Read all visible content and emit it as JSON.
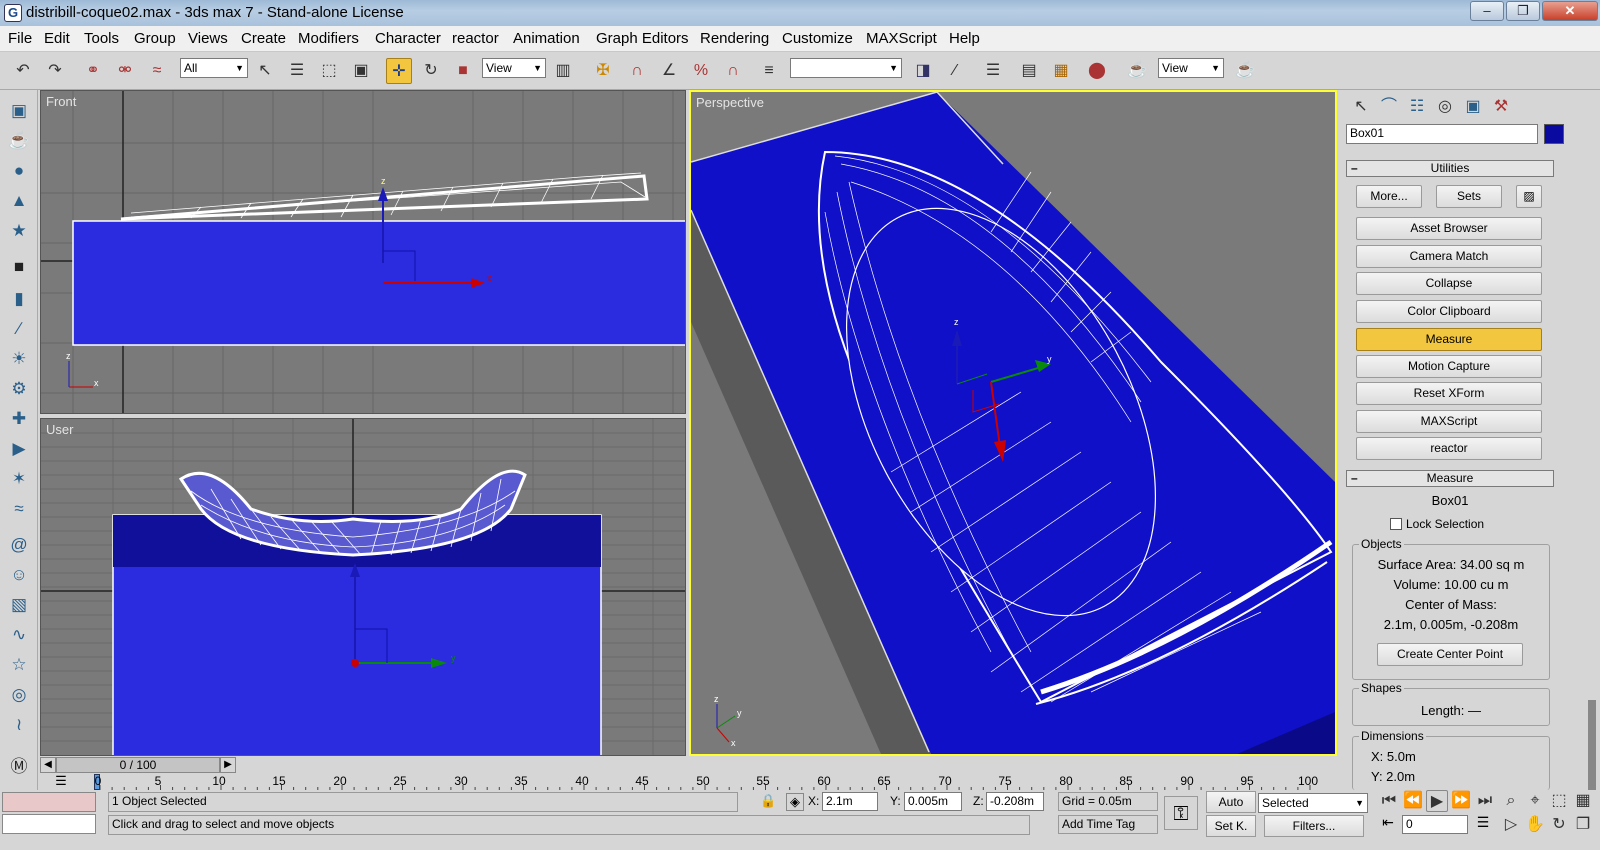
{
  "window": {
    "title": "distribill-coque02.max - 3ds max 7  - Stand-alone License",
    "app_icon": "G",
    "controls": [
      "minimize-icon",
      "maximize-icon",
      "close-icon"
    ]
  },
  "menu": [
    "File",
    "Edit",
    "Tools",
    "Group",
    "Views",
    "Create",
    "Modifiers",
    "Character",
    "reactor",
    "Animation",
    "Graph Editors",
    "Rendering",
    "Customize",
    "MAXScript",
    "Help"
  ],
  "toolbar": {
    "selection_filter": "All",
    "ref_coord": "View",
    "named_selection": "",
    "render_type": "View"
  },
  "viewports": {
    "front": "Front",
    "user": "User",
    "perspective": "Perspective"
  },
  "command_panel": {
    "object_name": "Box01",
    "object_color": "#0a0aa0",
    "utilities_title": "Utilities",
    "more_label": "More...",
    "sets_label": "Sets",
    "utility_buttons": [
      "Asset Browser",
      "Camera Match",
      "Collapse",
      "Color Clipboard",
      "Measure",
      "Motion Capture",
      "Reset XForm",
      "MAXScript",
      "reactor"
    ],
    "active_utility": "Measure",
    "measure": {
      "title": "Measure",
      "object": "Box01",
      "lock_selection": "Lock Selection",
      "objects_group": "Objects",
      "surface_area": "Surface Area:  34.00 sq m",
      "volume": "Volume:  10.00 cu m",
      "center_of_mass_label": "Center of Mass:",
      "center_of_mass_value": "2.1m, 0.005m, -0.208m",
      "create_center_point": "Create Center Point",
      "shapes_group": "Shapes",
      "length": "Length:  —",
      "dimensions_group": "Dimensions",
      "dim_x": "X:   5.0m",
      "dim_y": "Y:   2.0m"
    }
  },
  "timeline": {
    "frame_counter": "0 / 100",
    "ticks": [
      "0",
      "5",
      "10",
      "15",
      "20",
      "25",
      "30",
      "35",
      "40",
      "45",
      "50",
      "55",
      "60",
      "65",
      "70",
      "75",
      "80",
      "85",
      "90",
      "95",
      "100"
    ]
  },
  "status": {
    "selection": "1 Object Selected",
    "prompt": "Click and drag to select and move objects",
    "x_label": "X:",
    "x_value": "2.1m",
    "y_label": "Y:",
    "y_value": "0.005m",
    "z_label": "Z:",
    "z_value": "-0.208m",
    "grid": "Grid = 0.05m",
    "add_time_tag": "Add Time Tag",
    "auto_key": "Auto",
    "set_key": "Set K.",
    "key_filter": "Selected",
    "filters": "Filters...",
    "current_frame": "0"
  },
  "colors": {
    "viewport_bg": "#7a7a7a",
    "box_blue": "#2b2be0",
    "active_yellow": "#f3c640"
  }
}
